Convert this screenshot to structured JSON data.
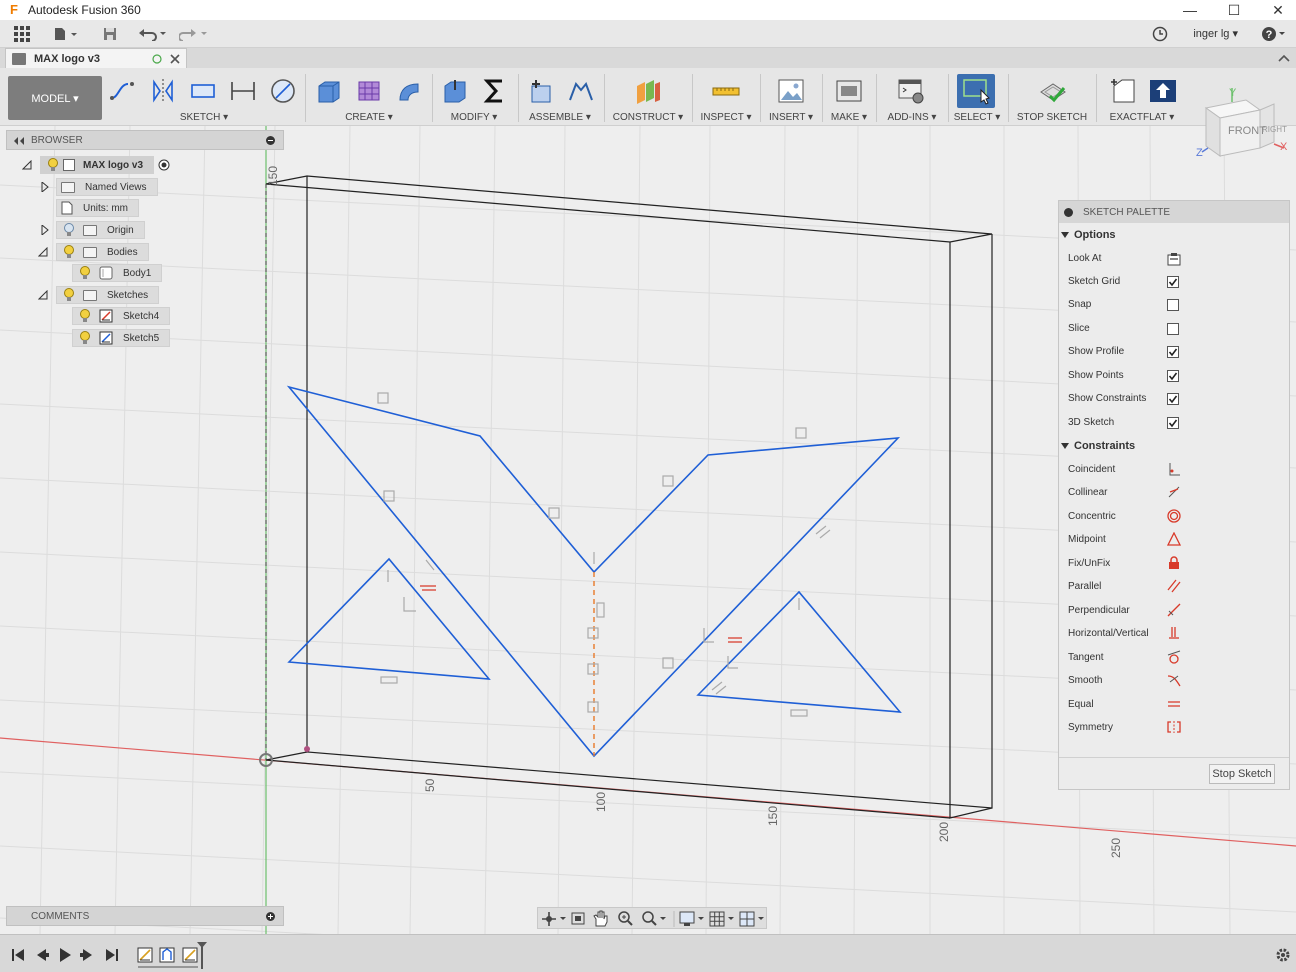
{
  "window": {
    "title": "Autodesk Fusion 360",
    "app_icon_glyph": "F",
    "controls": [
      "—",
      "☐",
      "✕"
    ]
  },
  "quick_access": {
    "user": "inger lg"
  },
  "document_tab": {
    "name": "MAX logo v3"
  },
  "ribbon": {
    "workspace": "MODEL ▾",
    "groups": {
      "sketch": "SKETCH ▾",
      "create": "CREATE ▾",
      "modify": "MODIFY ▾",
      "assemble": "ASSEMBLE ▾",
      "construct": "CONSTRUCT ▾",
      "inspect": "INSPECT ▾",
      "insert": "INSERT ▾",
      "make": "MAKE ▾",
      "addins": "ADD-INS ▾",
      "select": "SELECT ▾",
      "stop_sketch": "STOP SKETCH",
      "exactflat": "EXACTFLAT ▾"
    }
  },
  "viewcube": {
    "front": "FRONT",
    "right": "RIGHT",
    "axes": {
      "x": "X",
      "y": "Y",
      "z": "Z"
    }
  },
  "browser": {
    "title": "BROWSER",
    "items": [
      {
        "label": "MAX logo v3"
      },
      {
        "label": "Named Views"
      },
      {
        "label": "Units: mm"
      },
      {
        "label": "Origin"
      },
      {
        "label": "Bodies"
      },
      {
        "label": "Body1"
      },
      {
        "label": "Sketches"
      },
      {
        "label": "Sketch4"
      },
      {
        "label": "Sketch5"
      }
    ]
  },
  "axis_labels": {
    "y150": "150",
    "x50": "50",
    "x100": "100",
    "x150": "150",
    "x200": "200",
    "x250": "250"
  },
  "sketch_palette": {
    "title": "SKETCH PALETTE",
    "options_title": "Options",
    "options": [
      {
        "label": "Look At",
        "type": "icon",
        "checked": false
      },
      {
        "label": "Sketch Grid",
        "type": "checkbox",
        "checked": true
      },
      {
        "label": "Snap",
        "type": "checkbox",
        "checked": false
      },
      {
        "label": "Slice",
        "type": "checkbox",
        "checked": false
      },
      {
        "label": "Show Profile",
        "type": "checkbox",
        "checked": true
      },
      {
        "label": "Show Points",
        "type": "checkbox",
        "checked": true
      },
      {
        "label": "Show Constraints",
        "type": "checkbox",
        "checked": true
      },
      {
        "label": "3D Sketch",
        "type": "checkbox",
        "checked": true
      }
    ],
    "constraints_title": "Constraints",
    "constraints": [
      {
        "label": "Coincident",
        "icon": "coincident-icon"
      },
      {
        "label": "Collinear",
        "icon": "collinear-icon"
      },
      {
        "label": "Concentric",
        "icon": "concentric-icon"
      },
      {
        "label": "Midpoint",
        "icon": "midpoint-icon"
      },
      {
        "label": "Fix/UnFix",
        "icon": "lock-icon"
      },
      {
        "label": "Parallel",
        "icon": "parallel-icon"
      },
      {
        "label": "Perpendicular",
        "icon": "perpendicular-icon"
      },
      {
        "label": "Horizontal/Vertical",
        "icon": "horizontal-vertical-icon"
      },
      {
        "label": "Tangent",
        "icon": "tangent-icon"
      },
      {
        "label": "Smooth",
        "icon": "smooth-icon"
      },
      {
        "label": "Equal",
        "icon": "equal-icon"
      },
      {
        "label": "Symmetry",
        "icon": "symmetry-icon"
      }
    ],
    "stop_button": "Stop Sketch"
  },
  "comments": {
    "title": "COMMENTS"
  },
  "colors": {
    "sketch_line": "#1f5fd6",
    "constraint_red": "#d83a2a",
    "axis_x": "#e06060",
    "axis_y": "#6cc06c",
    "centerline": "#e87a2a"
  }
}
